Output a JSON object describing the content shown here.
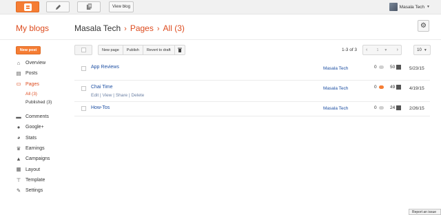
{
  "topbar": {
    "view_blog_label": "View blog",
    "user_name": "Masala Tech",
    "caret": "▼"
  },
  "header": {
    "my_blogs": "My blogs",
    "blog_name": "Masala Tech",
    "sep1": "›",
    "section": "Pages",
    "sep2": "›",
    "filter": "All (3)"
  },
  "sidebar": {
    "new_post_label": "New post",
    "items": [
      {
        "label": "Overview",
        "icon": "home-icon"
      },
      {
        "label": "Posts",
        "icon": "posts-icon"
      },
      {
        "label": "Pages",
        "icon": "pages-icon"
      },
      {
        "label": "All (3)"
      },
      {
        "label": "Published (3)"
      },
      {
        "label": "Comments",
        "icon": "comments-icon"
      },
      {
        "label": "Google+",
        "icon": "google-plus-icon"
      },
      {
        "label": "Stats",
        "icon": "stats-icon"
      },
      {
        "label": "Earnings",
        "icon": "earnings-icon"
      },
      {
        "label": "Campaigns",
        "icon": "campaigns-icon"
      },
      {
        "label": "Layout",
        "icon": "layout-icon"
      },
      {
        "label": "Template",
        "icon": "template-icon"
      },
      {
        "label": "Settings",
        "icon": "settings-icon"
      }
    ]
  },
  "toolbar": {
    "new_page_label": "New page",
    "publish_label": "Publish",
    "revert_label": "Revert to draft",
    "trash": "🗑",
    "pager_text": "1-3 of 3",
    "pager_prev": "‹",
    "pager_page": "1",
    "pager_next": "›",
    "per_page": "10",
    "caret": "▼"
  },
  "pages": [
    {
      "title": "App Reviews",
      "blog": "Masala Tech",
      "comments": "0",
      "views": "50",
      "date": "5/23/15",
      "has_new_comment": false
    },
    {
      "title": "Chai Time",
      "blog": "Masala Tech",
      "comments": "0",
      "views": "49",
      "date": "4/19/15",
      "has_new_comment": true,
      "actions": {
        "edit": "Edit",
        "view": "View",
        "share": "Share",
        "delete": "Delete",
        "sep": " | "
      }
    },
    {
      "title": "How-Tos",
      "blog": "Masala Tech",
      "comments": "0",
      "views": "24",
      "date": "2/26/15",
      "has_new_comment": false
    }
  ],
  "footer": {
    "report_label": "Report an issue"
  },
  "colors": {
    "accent": "#dd4b1e",
    "button_orange": "#f57d34",
    "link_blue": "#1c4ea2"
  }
}
